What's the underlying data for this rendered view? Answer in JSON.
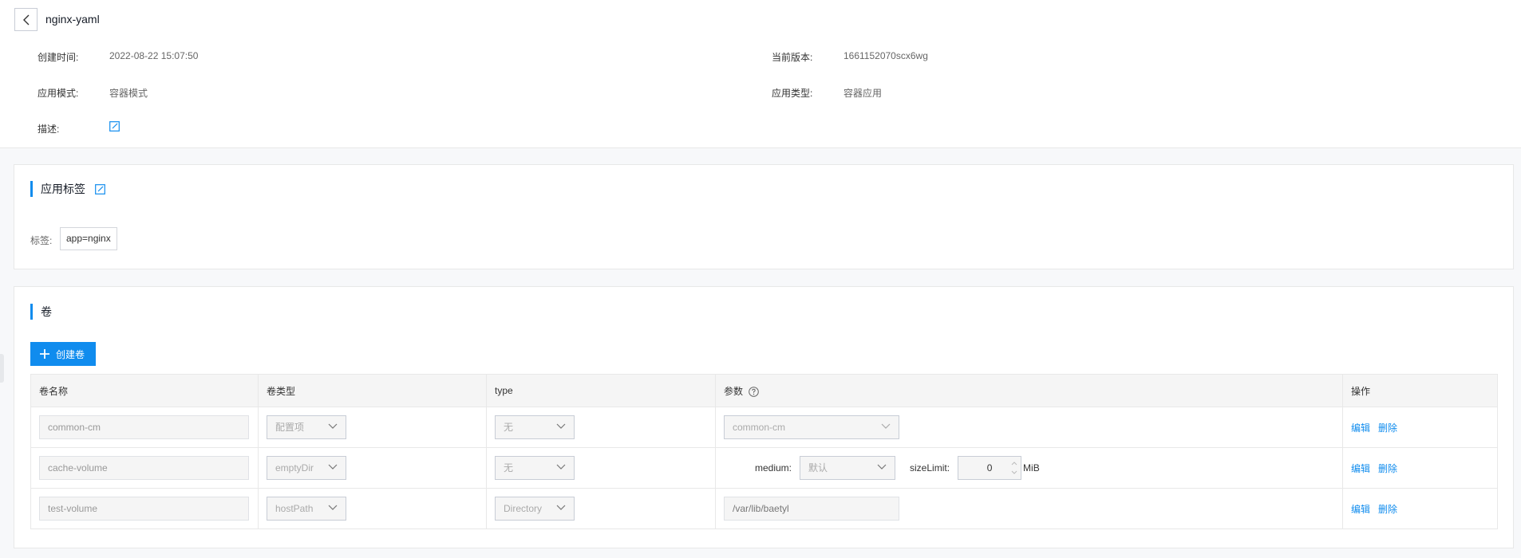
{
  "header": {
    "title": "nginx-yaml",
    "create_time_label": "创建时间:",
    "create_time_value": "2022-08-22 15:07:50",
    "current_version_label": "当前版本:",
    "current_version_value": "1661152070scx6wg",
    "app_mode_label": "应用模式:",
    "app_mode_value": "容器模式",
    "app_type_label": "应用类型:",
    "app_type_value": "容器应用",
    "desc_label": "描述:"
  },
  "labels_section": {
    "title": "应用标签",
    "tag_label": "标签:",
    "tag_value": "app=nginx"
  },
  "volumes_section": {
    "title": "卷",
    "create_button": "创建卷",
    "columns": {
      "name": "卷名称",
      "vtype": "卷类型",
      "type": "type",
      "params": "参数",
      "ops": "操作"
    },
    "rows": [
      {
        "name": "common-cm",
        "vtype": "配置项",
        "type": "无",
        "param_select": "common-cm"
      },
      {
        "name": "cache-volume",
        "vtype": "emptyDir",
        "type": "无",
        "medium_label": "medium:",
        "medium_value": "默认",
        "size_label": "sizeLimit:",
        "size_value": "0",
        "size_unit": "MiB"
      },
      {
        "name": "test-volume",
        "vtype": "hostPath",
        "type": "Directory",
        "param_path": "/var/lib/baetyl"
      }
    ],
    "edit_label": "编辑",
    "delete_label": "删除"
  },
  "colors": {
    "accent": "#108cee"
  },
  "icons": [
    "chevron-left-icon",
    "edit-icon",
    "plus-icon",
    "chevron-down-icon",
    "help-icon"
  ]
}
